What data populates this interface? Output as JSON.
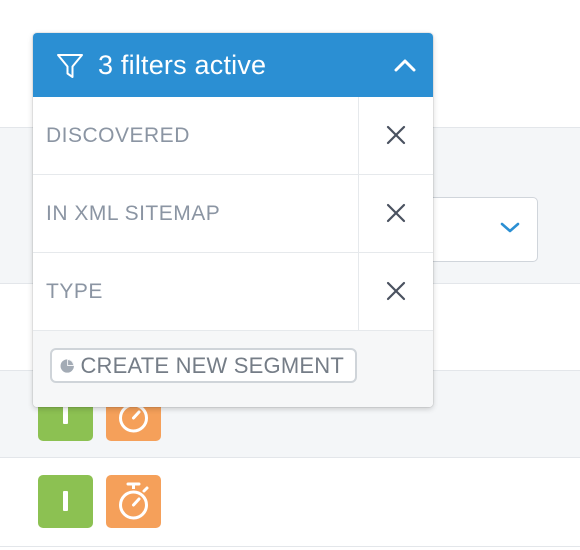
{
  "filter_dropdown": {
    "title": "3 filters active",
    "expanded": true,
    "header_color": "#2b8fd3",
    "header_icon": "funnel-icon",
    "toggle_icon": "chevron-up-icon",
    "filters": [
      {
        "label": "DISCOVERED",
        "remove_icon": "close-icon"
      },
      {
        "label": "IN XML SITEMAP",
        "remove_icon": "close-icon"
      },
      {
        "label": "TYPE",
        "remove_icon": "close-icon"
      }
    ],
    "create_segment": {
      "label": "CREATE NEW SEGMENT",
      "icon": "pie-chart-icon"
    }
  },
  "background": {
    "select_icon": "chevron-down-icon",
    "rows": [
      {
        "badges": [
          {
            "icon": "indexable-bar-icon",
            "color": "#8cc152"
          },
          {
            "icon": "stopwatch-icon",
            "color": "#f5a05a"
          }
        ]
      },
      {
        "badges": [
          {
            "icon": "indexable-bar-icon",
            "color": "#8cc152"
          },
          {
            "icon": "stopwatch-icon",
            "color": "#f5a05a"
          }
        ]
      }
    ]
  }
}
